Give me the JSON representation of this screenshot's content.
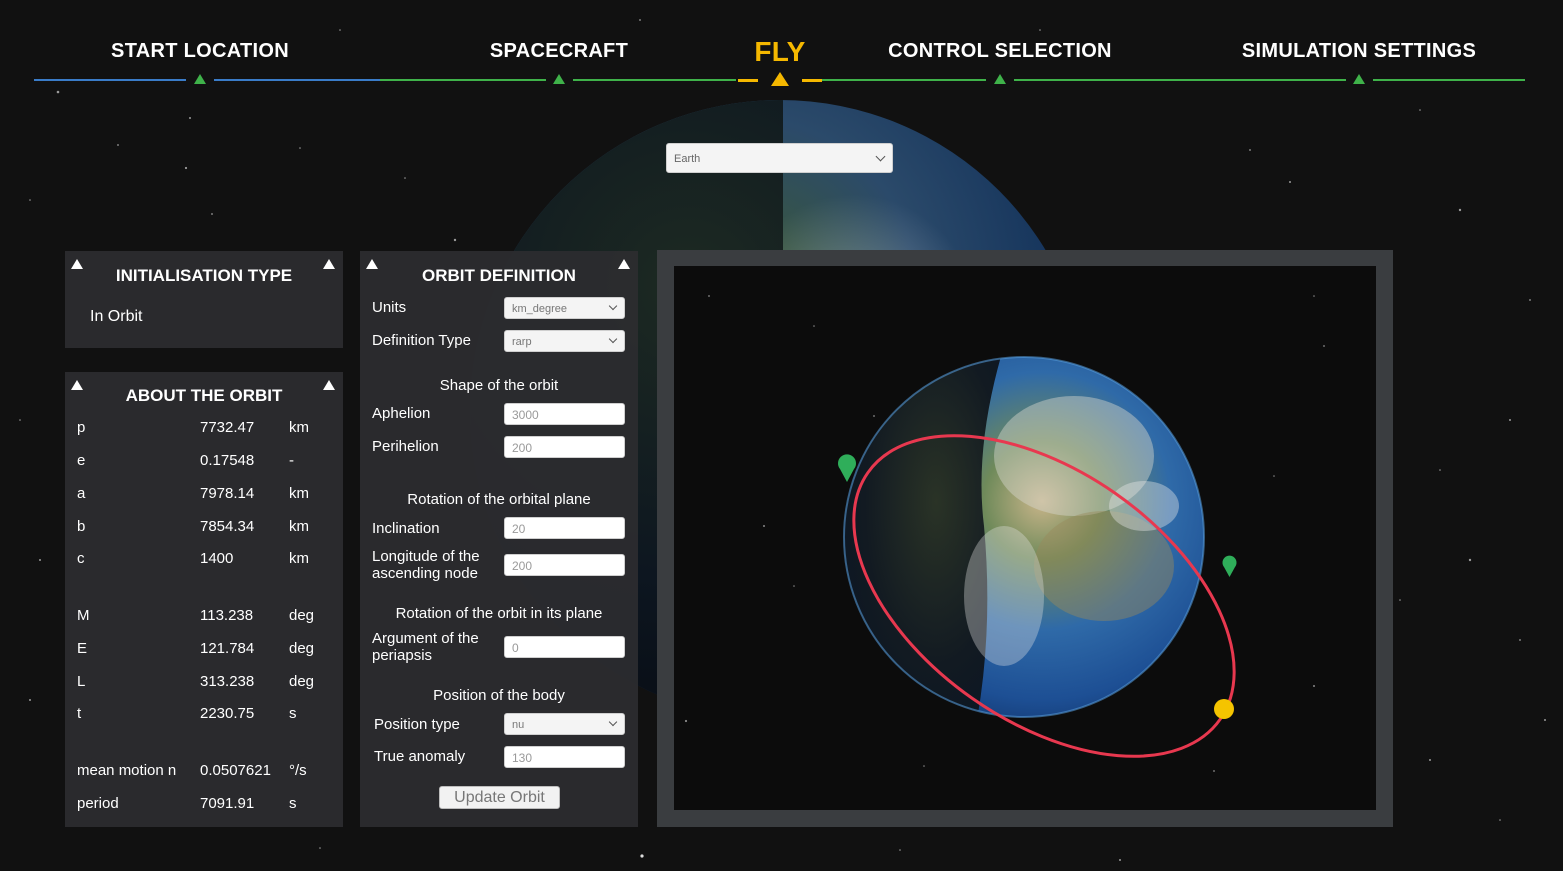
{
  "nav": {
    "items": [
      {
        "label": "START LOCATION",
        "active": false
      },
      {
        "label": "SPACECRAFT",
        "active": false
      },
      {
        "label": "FLY",
        "active": true
      },
      {
        "label": "CONTROL SELECTION",
        "active": false
      },
      {
        "label": "SIMULATION SETTINGS",
        "active": false
      }
    ]
  },
  "planet_select": {
    "value": "Earth"
  },
  "init_panel": {
    "title": "INITIALISATION TYPE",
    "value": "In Orbit"
  },
  "about_panel": {
    "title": "ABOUT THE ORBIT",
    "rows": [
      {
        "key": "p",
        "value": "7732.47",
        "unit": "km"
      },
      {
        "key": "e",
        "value": "0.17548",
        "unit": "-"
      },
      {
        "key": "a",
        "value": "7978.14",
        "unit": "km"
      },
      {
        "key": "b",
        "value": "7854.34",
        "unit": "km"
      },
      {
        "key": "c",
        "value": "1400",
        "unit": "km"
      },
      {
        "key": "M",
        "value": "113.238",
        "unit": "deg"
      },
      {
        "key": "E",
        "value": "121.784",
        "unit": "deg"
      },
      {
        "key": "L",
        "value": "313.238",
        "unit": "deg"
      },
      {
        "key": "t",
        "value": "2230.75",
        "unit": "s"
      },
      {
        "key": "mean motion n",
        "value": "0.0507621",
        "unit": "°/s"
      },
      {
        "key": "period",
        "value": "7091.91",
        "unit": "s"
      }
    ]
  },
  "orbit_panel": {
    "title": "ORBIT DEFINITION",
    "units_label": "Units",
    "units_value": "km_degree",
    "def_type_label": "Definition Type",
    "def_type_value": "rarp",
    "shape_section": "Shape of the orbit",
    "aphelion_label": "Aphelion",
    "aphelion_value": "3000",
    "perihelion_label": "Perihelion",
    "perihelion_value": "200",
    "rotation_plane_section": "Rotation of the orbital plane",
    "inclination_label": "Inclination",
    "inclination_value": "20",
    "lan_label_1": "Longitude of the",
    "lan_label_2": "ascending node",
    "lan_value": "200",
    "rotation_orbit_section": "Rotation of the orbit in its plane",
    "argp_label_1": "Argument of the",
    "argp_label_2": "periapsis",
    "argp_value": "0",
    "position_section": "Position of the body",
    "position_type_label": "Position type",
    "position_type_value": "nu",
    "true_anomaly_label": "True anomaly",
    "true_anomaly_value": "130",
    "update_button": "Update Orbit"
  },
  "colors": {
    "active_nav": "#f5b800",
    "nav_marker": "#3fb24a",
    "orbit_line": "#e8384f",
    "body_marker": "#f5c400",
    "node_marker": "#2fae5a",
    "panel_bg": "#2d2d30"
  }
}
